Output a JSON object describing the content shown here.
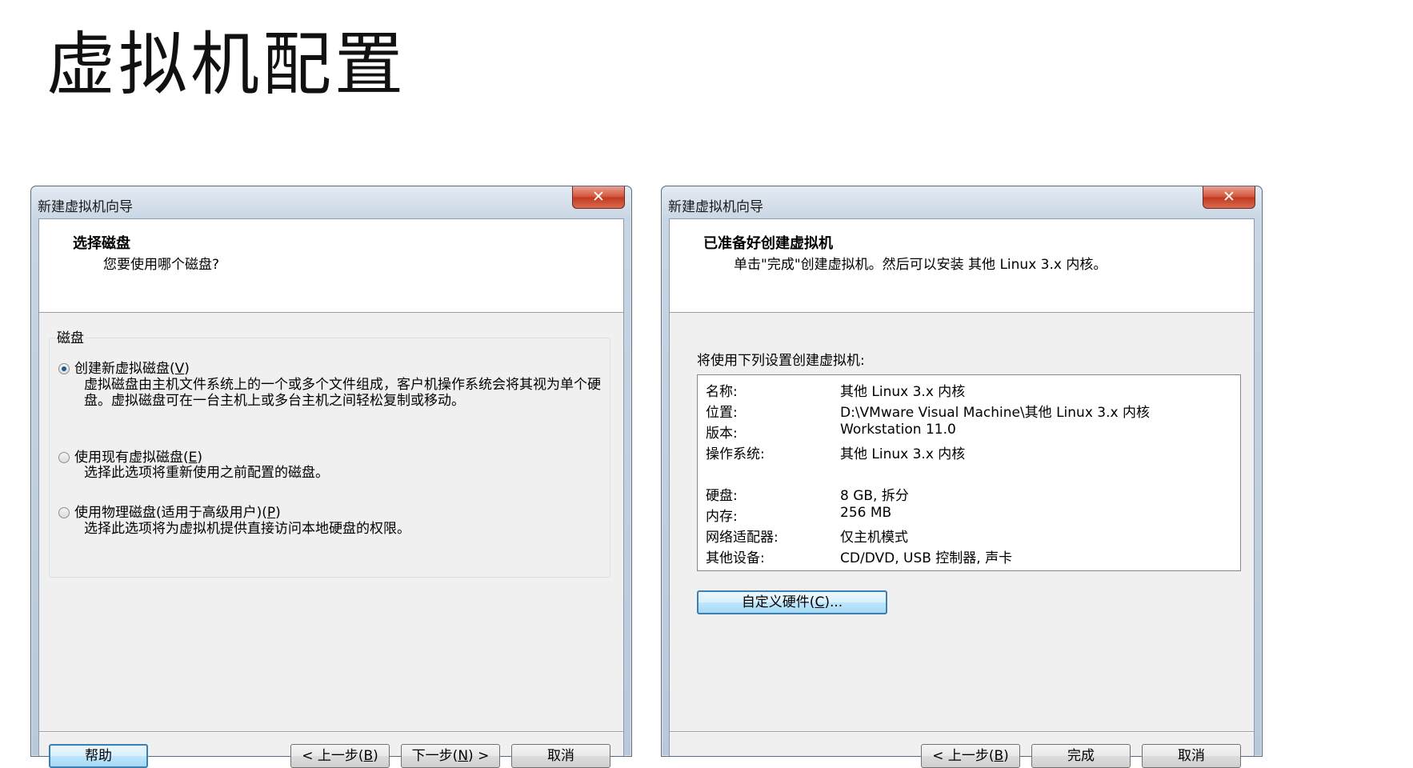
{
  "slide": {
    "title": "虚拟机配置"
  },
  "left_dialog": {
    "window_title": "新建虚拟机向导",
    "close_glyph": "✕",
    "header_title": "选择磁盘",
    "header_subtitle": "您要使用哪个磁盘?",
    "group_label": "磁盘",
    "options": [
      {
        "label": "创建新虚拟磁盘(",
        "mnemonic": "V",
        "label_end": ")",
        "checked": true,
        "desc": "虚拟磁盘由主机文件系统上的一个或多个文件组成，客户机操作系统会将其视为单个硬盘。虚拟磁盘可在一台主机上或多台主机之间轻松复制或移动。"
      },
      {
        "label": "使用现有虚拟磁盘(",
        "mnemonic": "E",
        "label_end": ")",
        "checked": false,
        "desc": "选择此选项将重新使用之前配置的磁盘。"
      },
      {
        "label": "使用物理磁盘(适用于高级用户)(",
        "mnemonic": "P",
        "label_end": ")",
        "checked": false,
        "desc": "选择此选项将为虚拟机提供直接访问本地硬盘的权限。"
      }
    ],
    "buttons": {
      "help": "帮助",
      "back_pre": "< 上一步(",
      "back_key": "B",
      "back_post": ")",
      "next_pre": "下一步(",
      "next_key": "N",
      "next_post": ") >",
      "cancel": "取消"
    }
  },
  "right_dialog": {
    "window_title": "新建虚拟机向导",
    "close_glyph": "✕",
    "header_title": "已准备好创建虚拟机",
    "header_subtitle": "单击\"完成\"创建虚拟机。然后可以安装 其他 Linux 3.x 内核。",
    "intro": "将使用下列设置创建虚拟机:",
    "settings": [
      {
        "key": "名称:",
        "value": "其他 Linux 3.x 内核"
      },
      {
        "key": "位置:",
        "value": "D:\\VMware Visual Machine\\其他 Linux 3.x 内核"
      },
      {
        "key": "版本:",
        "value": "Workstation 11.0"
      },
      {
        "key": "操作系统:",
        "value": "其他 Linux 3.x 内核"
      },
      {
        "key": "硬盘:",
        "value": "8 GB, 拆分"
      },
      {
        "key": "内存:",
        "value": "256 MB"
      },
      {
        "key": "网络适配器:",
        "value": "仅主机模式"
      },
      {
        "key": "其他设备:",
        "value": "CD/DVD, USB 控制器, 声卡"
      }
    ],
    "custom_pre": "自定义硬件(",
    "custom_key": "C",
    "custom_post": ")...",
    "buttons": {
      "back_pre": "< 上一步(",
      "back_key": "B",
      "back_post": ")",
      "finish": "完成",
      "cancel": "取消"
    }
  }
}
